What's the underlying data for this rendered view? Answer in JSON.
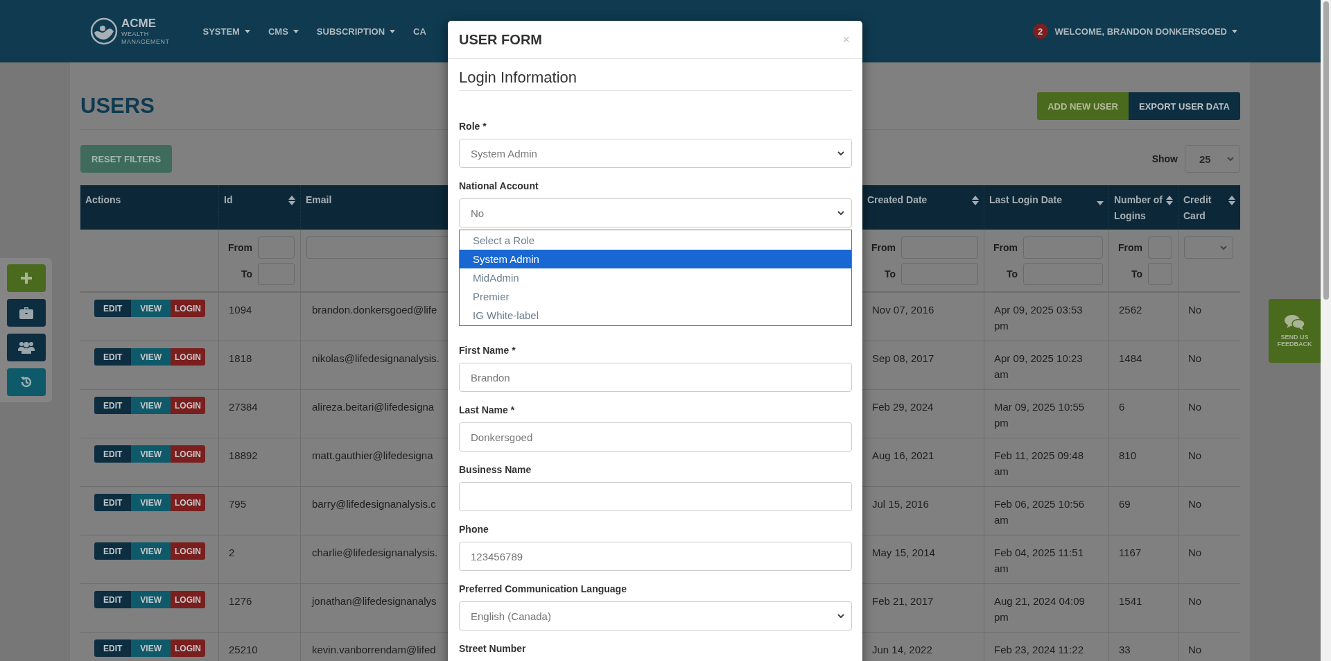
{
  "header": {
    "logo": {
      "name": "ACME",
      "tagline": "WEALTH MANAGEMENT"
    },
    "nav": [
      {
        "label": "SYSTEM",
        "dropdown": true
      },
      {
        "label": "CMS",
        "dropdown": true
      },
      {
        "label": "SUBSCRIPTION",
        "dropdown": true
      },
      {
        "label": "CA",
        "dropdown": false
      }
    ],
    "notifications": "2",
    "user_menu": "WELCOME, BRANDON DONKERSGOED"
  },
  "page": {
    "title": "USERS",
    "actions": [
      {
        "label": "ADD NEW USER",
        "kind": "add"
      },
      {
        "label": "EXPORT USER DATA",
        "kind": "export"
      }
    ],
    "reset_filters": "RESET FILTERS",
    "page_size": {
      "label": "Show",
      "value": "25"
    }
  },
  "table": {
    "actions_column": {
      "label": "Actions"
    },
    "columns": [
      {
        "label": "Id",
        "sortable": true,
        "sorted_descending": false,
        "filter": {
          "kind": "range",
          "from_label": "From",
          "to_label": "To"
        }
      },
      {
        "label": "Email",
        "sortable": false,
        "sorted_descending": false,
        "filter": {
          "kind": "text"
        }
      },
      {
        "label": "Created Date",
        "sortable": true,
        "sorted_descending": false,
        "filter": {
          "kind": "range",
          "from_label": "From",
          "to_label": "To"
        }
      },
      {
        "label": "Last Login Date",
        "sortable": true,
        "sorted_descending": true,
        "filter": {
          "kind": "range",
          "from_label": "From",
          "to_label": "To"
        }
      },
      {
        "label": "Number of Logins",
        "sortable": true,
        "sorted_descending": false,
        "filter": {
          "kind": "range",
          "from_label": "From",
          "to_label": "To"
        }
      },
      {
        "label": "Credit Card",
        "sortable": true,
        "sorted_descending": false,
        "filter": {
          "kind": "select"
        }
      }
    ],
    "rows": [
      {
        "actions": [
          "EDIT",
          "VIEW",
          "LOGIN"
        ],
        "cells": [
          "1094",
          "brandon.donkersgoed@life",
          "Nov 07, 2016",
          "Apr 09, 2025 03:53 pm",
          "2562",
          "No"
        ]
      },
      {
        "actions": [
          "EDIT",
          "VIEW",
          "LOGIN"
        ],
        "cells": [
          "1818",
          "nikolas@lifedesignanalysis.",
          "Sep 08, 2017",
          "Apr 09, 2025 10:23 am",
          "1484",
          "No"
        ]
      },
      {
        "actions": [
          "EDIT",
          "VIEW",
          "LOGIN"
        ],
        "cells": [
          "27384",
          "alireza.beitari@lifedesigna",
          "Feb 29, 2024",
          "Mar 09, 2025 10:55 pm",
          "6",
          "No"
        ]
      },
      {
        "actions": [
          "EDIT",
          "VIEW",
          "LOGIN"
        ],
        "cells": [
          "18892",
          "matt.gauthier@lifedesigna",
          "Aug 16, 2021",
          "Feb 11, 2025 09:48 am",
          "810",
          "No"
        ]
      },
      {
        "actions": [
          "EDIT",
          "VIEW",
          "LOGIN"
        ],
        "cells": [
          "795",
          "barry@lifedesignanalysis.c",
          "Jul 15, 2016",
          "Feb 06, 2025 10:56 am",
          "69",
          "No"
        ]
      },
      {
        "actions": [
          "EDIT",
          "VIEW",
          "LOGIN"
        ],
        "cells": [
          "2",
          "charlie@lifedesignanalysis.",
          "May 15, 2014",
          "Feb 04, 2025 11:51 am",
          "1167",
          "No"
        ]
      },
      {
        "actions": [
          "EDIT",
          "VIEW",
          "LOGIN"
        ],
        "cells": [
          "1276",
          "jonathan@lifedesignanalys",
          "Feb 21, 2017",
          "Aug 21, 2024 04:09 pm",
          "1541",
          "No"
        ]
      },
      {
        "actions": [
          "EDIT",
          "VIEW",
          "LOGIN"
        ],
        "cells": [
          "25210",
          "kevin.vanborrendam@lifed",
          "Jun 14, 2022",
          "Feb 23, 2024 11:22",
          "33",
          "No"
        ]
      }
    ]
  },
  "feedback": {
    "label": "SEND US FEEDBACK"
  },
  "modal": {
    "title": "USER FORM",
    "close": "×",
    "section": "Login Information",
    "fields": [
      {
        "kind": "select",
        "label": "Role *",
        "value": "System Admin"
      },
      {
        "kind": "select",
        "label": "National Account",
        "value": "No"
      },
      {
        "kind": "dropdown_list",
        "options": [
          {
            "label": "Select a Role",
            "selected": false
          },
          {
            "label": "System Admin",
            "selected": true
          },
          {
            "label": "MidAdmin",
            "selected": false
          },
          {
            "label": "Premier",
            "selected": false
          },
          {
            "label": "IG White-label",
            "selected": false
          }
        ]
      },
      {
        "kind": "text",
        "label": "First Name *",
        "value": "Brandon"
      },
      {
        "kind": "text",
        "label": "Last Name *",
        "value": "Donkersgoed"
      },
      {
        "kind": "text",
        "label": "Business Name"
      },
      {
        "kind": "text",
        "label": "Phone",
        "value": "123456789"
      },
      {
        "kind": "select",
        "label": "Preferred Communication Language",
        "value": "English (Canada)"
      },
      {
        "kind": "text",
        "label": "Street Number"
      }
    ]
  }
}
